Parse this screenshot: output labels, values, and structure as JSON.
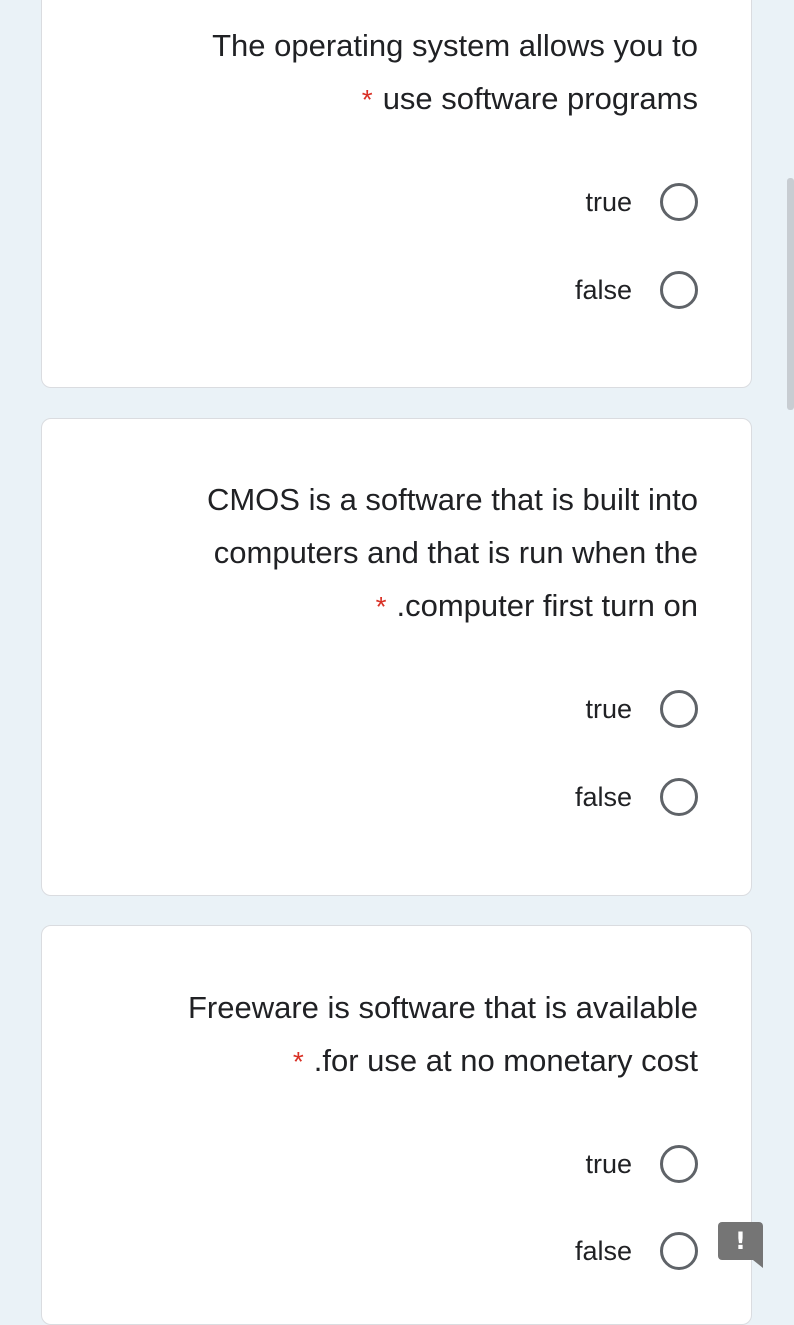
{
  "questions": [
    {
      "lines": [
        "The operating system allows you to",
        "use software programs"
      ],
      "required_mark": "*",
      "options": [
        {
          "label": "true",
          "selected": false
        },
        {
          "label": "false",
          "selected": false
        }
      ]
    },
    {
      "lines": [
        "CMOS is a software that is built into",
        "computers and that is run when the",
        ".computer first turn on"
      ],
      "required_mark": "*",
      "options": [
        {
          "label": "true",
          "selected": false
        },
        {
          "label": "false",
          "selected": false
        }
      ]
    },
    {
      "lines": [
        "Freeware is software that is available",
        ".for use at no monetary cost"
      ],
      "required_mark": "*",
      "options": [
        {
          "label": "true",
          "selected": false
        },
        {
          "label": "false",
          "selected": false
        }
      ]
    }
  ],
  "feedback_button": {
    "symbol": "!"
  },
  "colors": {
    "background": "#eaf2f7",
    "card": "#ffffff",
    "required": "#d93025",
    "radio_border": "#5f6368"
  }
}
